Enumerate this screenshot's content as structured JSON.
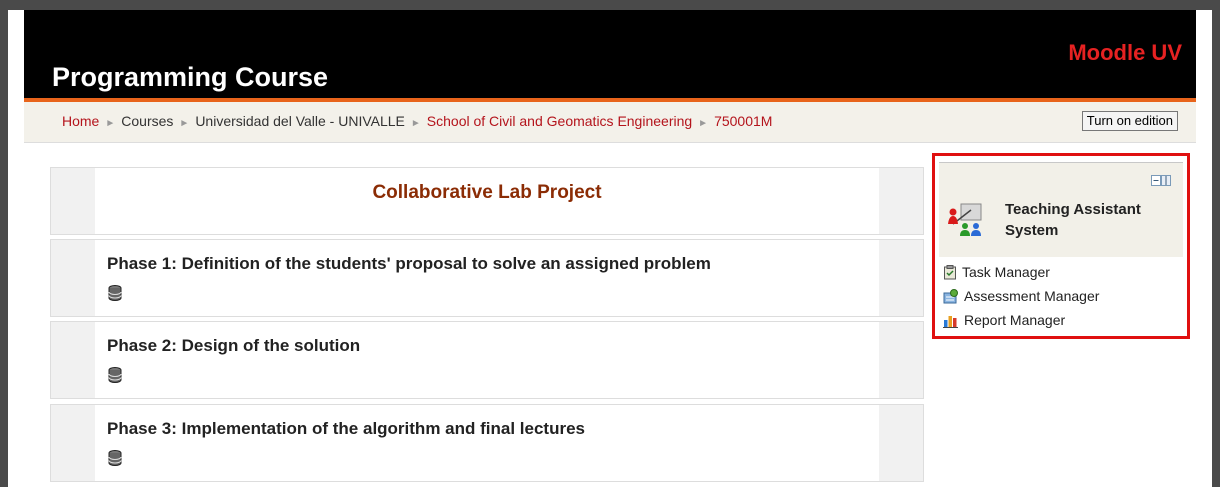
{
  "header": {
    "course_title": "Programming Course",
    "site_name": "Moodle UV"
  },
  "breadcrumb": {
    "items": [
      "Home",
      "Courses",
      "Universidad del Valle - UNIVALLE",
      "School of Civil and Geomatics Engineering",
      "750001M"
    ]
  },
  "actions": {
    "edit_button": "Turn on edition"
  },
  "sections": {
    "topic": "Collaborative Lab Project",
    "phases": [
      "Phase 1: Definition of the students' proposal to solve an assigned problem",
      "Phase 2: Design of the solution",
      "Phase 3: Implementation of the algorithm and final lectures"
    ]
  },
  "block": {
    "title_line1": "Teaching Assistant",
    "title_line2": "System",
    "links": [
      "Task Manager",
      "Assessment Manager",
      "Report Manager"
    ]
  },
  "colors": {
    "header_bg": "#000000",
    "accent": "#e8641b",
    "link": "#b4141c",
    "highlight_border": "#e01010"
  },
  "icons": [
    "collapse-icon",
    "teaching-assistant-icon",
    "task-icon",
    "assessment-icon",
    "report-icon",
    "database-icon"
  ]
}
